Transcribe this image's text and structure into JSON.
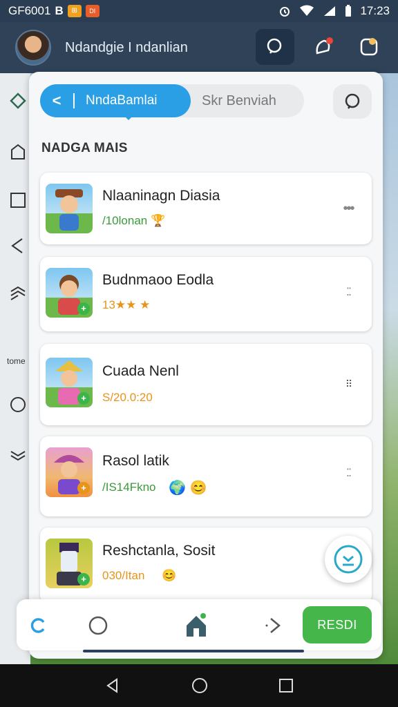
{
  "status_bar": {
    "left_text": "GF6001",
    "left_glyph": "B",
    "badge_a": "⊞",
    "badge_b": "DI",
    "time": "17:23"
  },
  "app_header": {
    "username": "Ndandgie I ndanlian"
  },
  "segmented": {
    "active_label": "NndaBamlai",
    "inactive_label": "Skr Benviah"
  },
  "section_title": "NADGA MAIS",
  "rail": {
    "label": "tome"
  },
  "cards": [
    {
      "title": "Nlaaninagn Diasia",
      "sub": "/10lonan",
      "sub_color": "#3a9a3a",
      "emoji": "🏆"
    },
    {
      "title": "Budnmaoo Eodla",
      "sub": "13★★ ★",
      "sub_color": "#e8941a",
      "emoji": ""
    },
    {
      "title": "Cuada Nenl",
      "sub": "S/20.0:20",
      "sub_color": "#e8941a",
      "emoji": ""
    },
    {
      "title": "Rasol latik",
      "sub": "/IS14Fkno",
      "sub_color": "#3a9a3a",
      "emoji": "🌍 😊"
    },
    {
      "title": "Reshctanla, Sosit",
      "sub": "030/Itan",
      "sub_color": "#e8941a",
      "emoji": "😊"
    }
  ],
  "bottom_bar": {
    "action_label": "RESDI"
  },
  "colors": {
    "accent_blue": "#2b9fe6",
    "action_green": "#45b64a",
    "header_bg": "#2f4258"
  }
}
